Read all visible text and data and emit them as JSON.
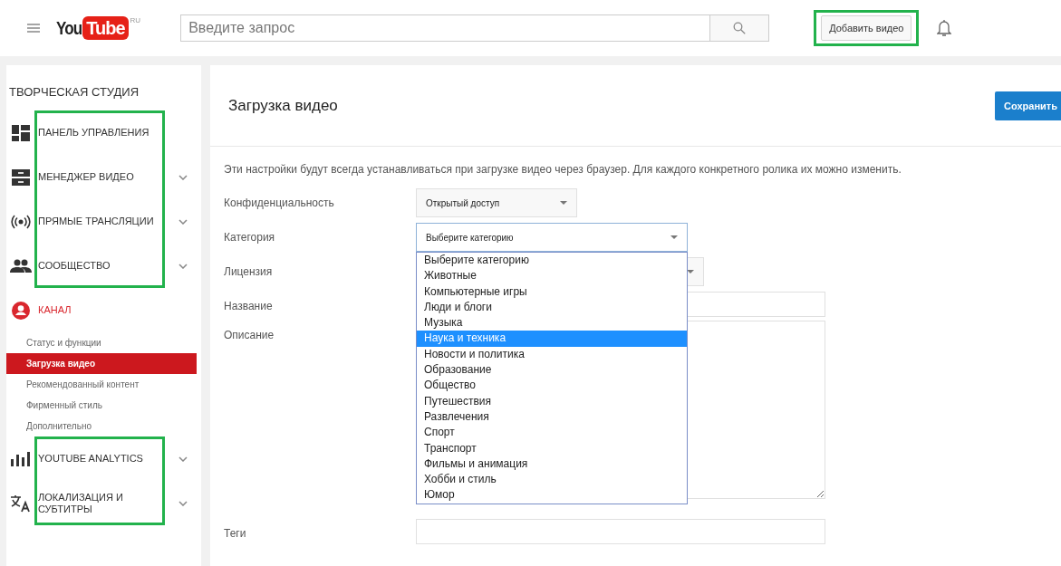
{
  "header": {
    "logo": {
      "you": "You",
      "tube": "Tube",
      "region": "RU"
    },
    "search": {
      "placeholder": "Введите запрос"
    },
    "add_video_button": {
      "label": "Добавить видео",
      "highlighted": true
    }
  },
  "sidebar": {
    "title": "ТВОРЧЕСКАЯ СТУДИЯ",
    "groups": [
      {
        "highlighted": true,
        "items": [
          {
            "kind": "section",
            "label": "ПАНЕЛЬ УПРАВЛЕНИЯ",
            "expandable": false,
            "active": false
          },
          {
            "kind": "section",
            "label": "МЕНЕДЖЕР ВИДЕО",
            "expandable": true,
            "active": false
          },
          {
            "kind": "section",
            "label": "ПРЯМЫЕ ТРАНСЛЯЦИИ",
            "expandable": true,
            "active": false
          },
          {
            "kind": "section",
            "label": "СООБЩЕСТВО",
            "expandable": true,
            "active": false
          }
        ]
      },
      {
        "items": [
          {
            "kind": "section",
            "label": "КАНАЛ",
            "expandable": false,
            "active": true
          },
          {
            "kind": "sub",
            "label": "Статус и функции",
            "selected": false
          },
          {
            "kind": "sub",
            "label": "Загрузка видео",
            "selected": true
          },
          {
            "kind": "sub",
            "label": "Рекомендованный контент",
            "selected": false
          },
          {
            "kind": "sub",
            "label": "Фирменный стиль",
            "selected": false
          },
          {
            "kind": "sub",
            "label": "Дополнительно",
            "selected": false
          }
        ]
      },
      {
        "highlighted": true,
        "items": [
          {
            "kind": "section",
            "label": "YOUTUBE ANALYTICS",
            "expandable": true,
            "active": false
          },
          {
            "kind": "section",
            "label": "ЛОКАЛИЗАЦИЯ И СУБТИТРЫ",
            "expandable": true,
            "active": false
          }
        ]
      }
    ]
  },
  "main": {
    "title": "Загрузка видео",
    "save_button": "Сохранить",
    "note": "Эти настройки будут всегда устанавливаться при загрузке видео через браузер. Для каждого конкретного ролика их можно изменить.",
    "fields": [
      {
        "kind": "select",
        "label": "Конфиденциальность",
        "value": "Открытый доступ",
        "open": false
      },
      {
        "kind": "select",
        "label": "Категория",
        "value": "Выберите категорию",
        "open": true,
        "options": [
          {
            "label": "Выберите категорию",
            "highlighted": false
          },
          {
            "label": "Животные",
            "highlighted": false
          },
          {
            "label": "Компьютерные игры",
            "highlighted": false
          },
          {
            "label": "Люди и блоги",
            "highlighted": false
          },
          {
            "label": "Музыка",
            "highlighted": false
          },
          {
            "label": "Наука и техника",
            "highlighted": true
          },
          {
            "label": "Новости и политика",
            "highlighted": false
          },
          {
            "label": "Образование",
            "highlighted": false
          },
          {
            "label": "Общество",
            "highlighted": false
          },
          {
            "label": "Путешествия",
            "highlighted": false
          },
          {
            "label": "Развлечения",
            "highlighted": false
          },
          {
            "label": "Спорт",
            "highlighted": false
          },
          {
            "label": "Транспорт",
            "highlighted": false
          },
          {
            "label": "Фильмы и анимация",
            "highlighted": false
          },
          {
            "label": "Хобби и стиль",
            "highlighted": false
          },
          {
            "label": "Юмор",
            "highlighted": false
          }
        ]
      },
      {
        "kind": "select",
        "label": "Лицензия",
        "open": false
      },
      {
        "kind": "text",
        "label": "Название"
      },
      {
        "kind": "textarea",
        "label": "Описание"
      },
      {
        "kind": "text",
        "label": "Теги"
      }
    ]
  }
}
